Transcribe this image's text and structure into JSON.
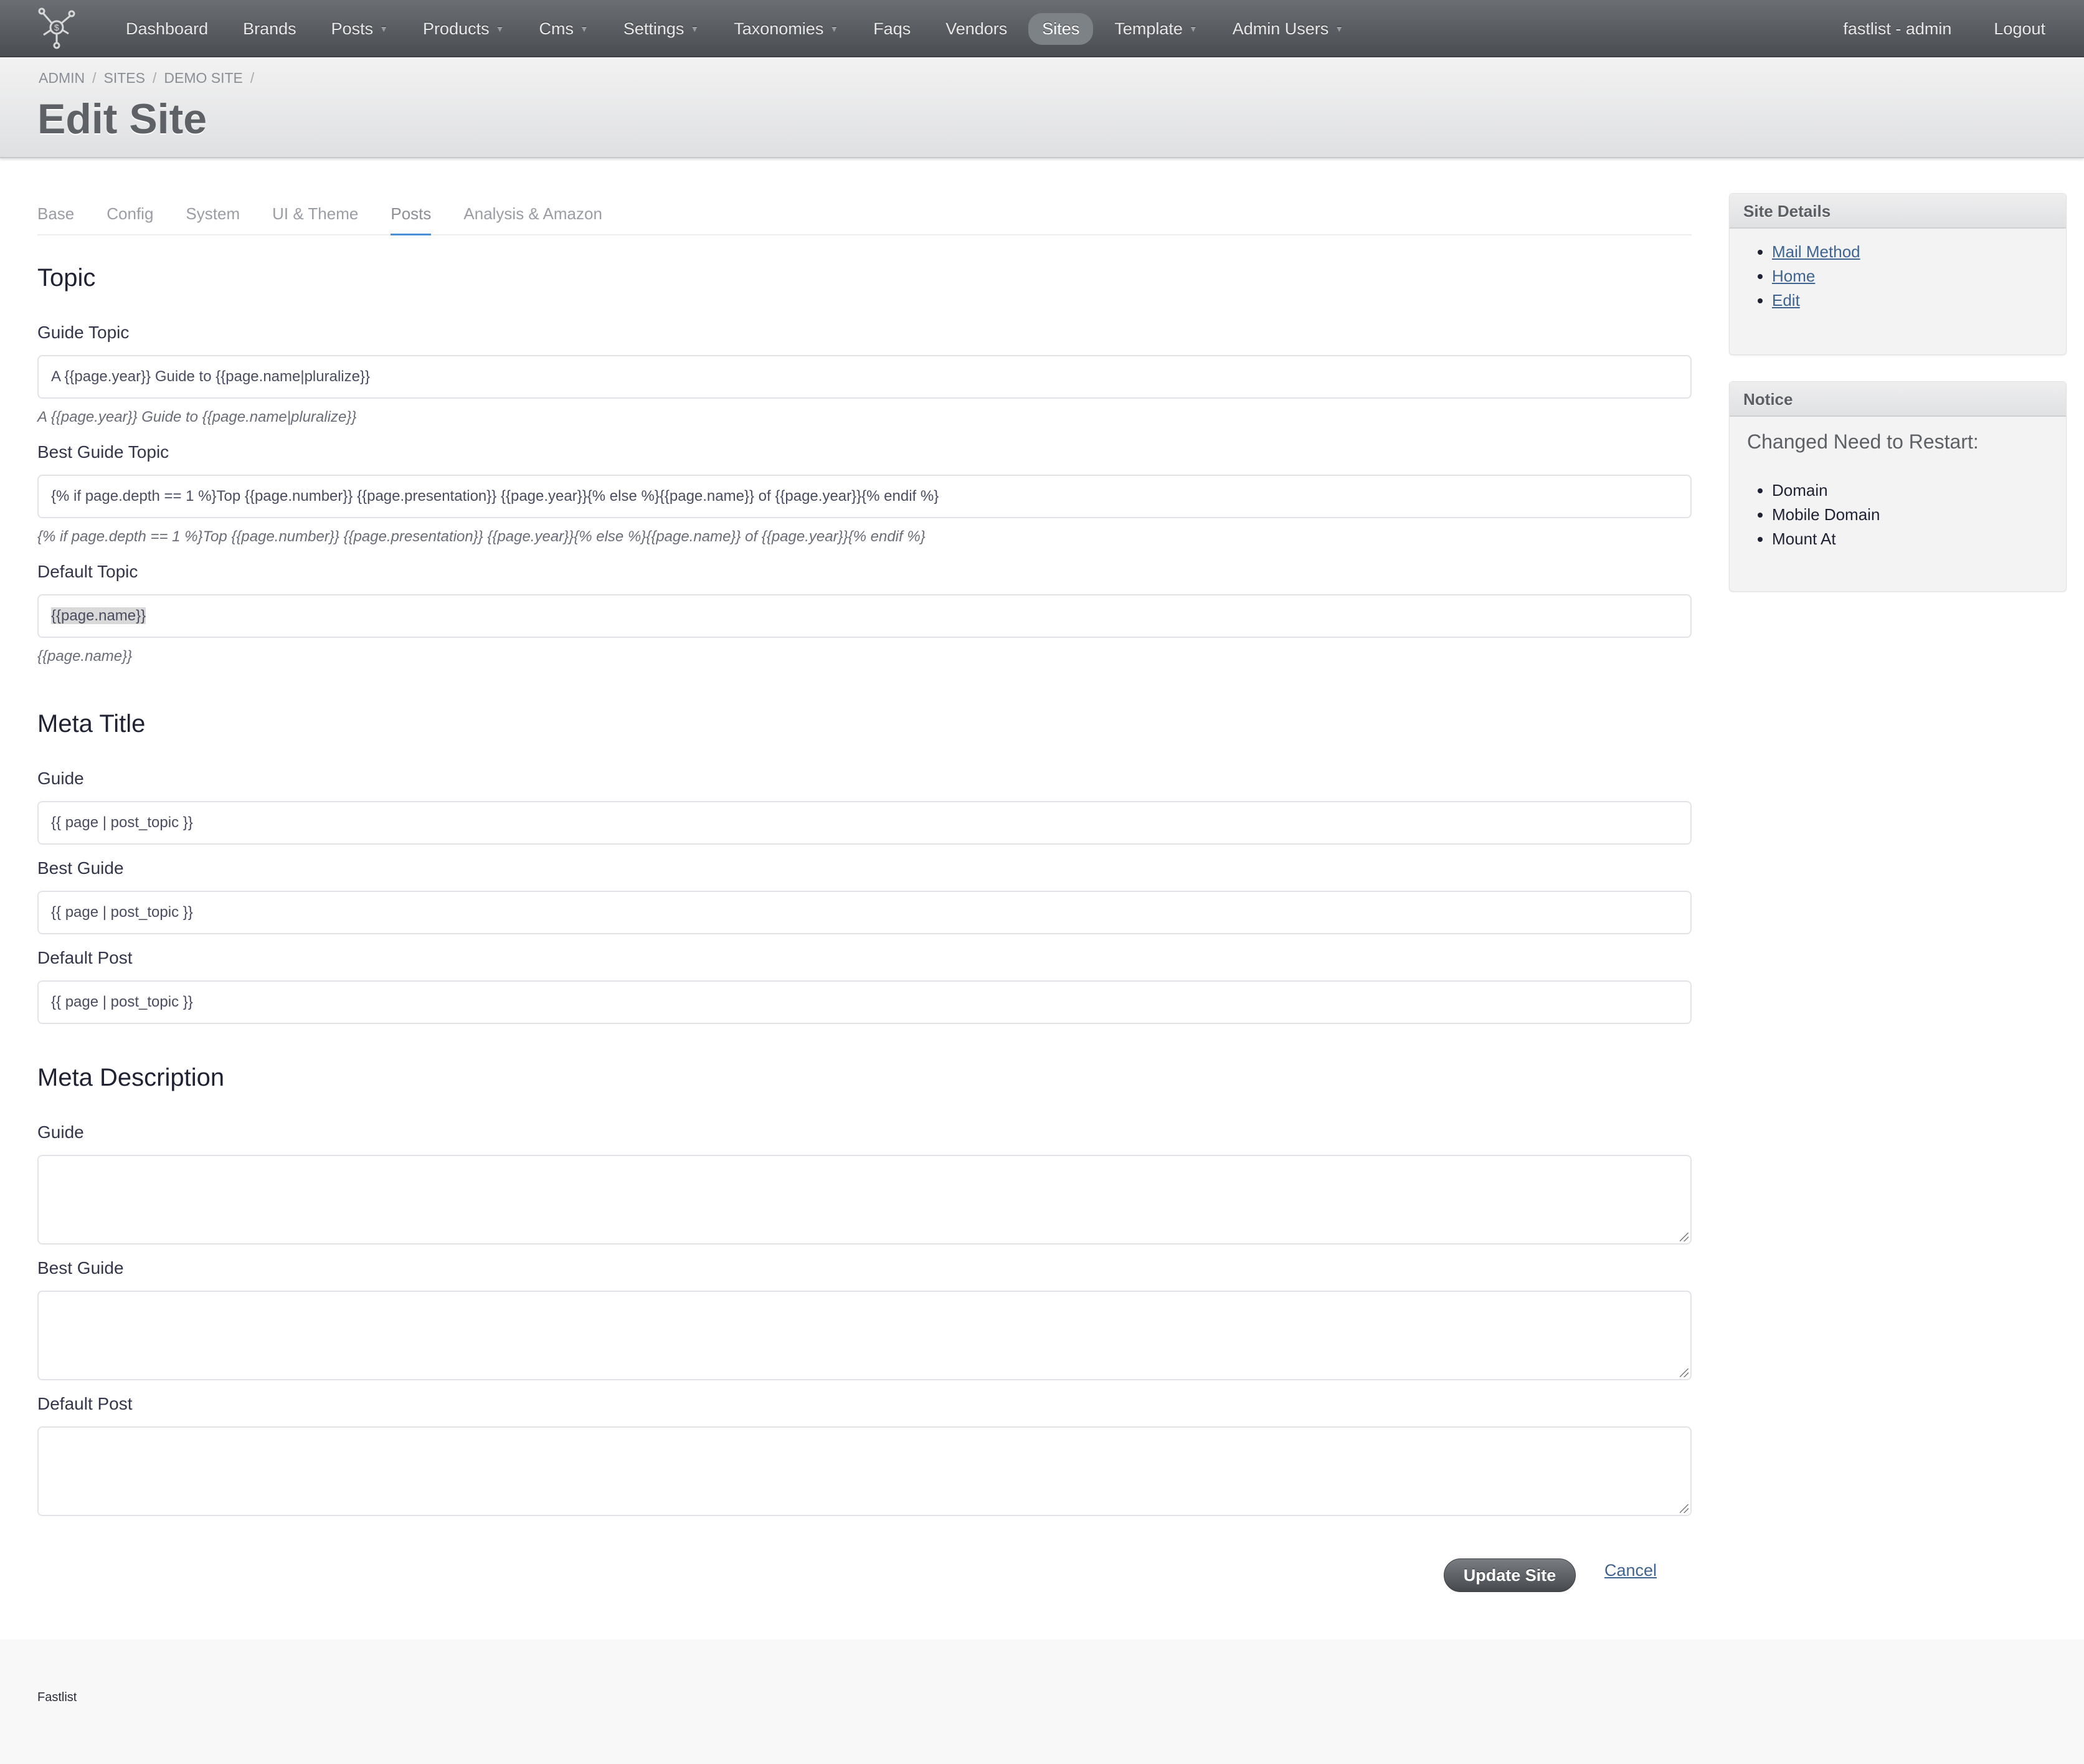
{
  "navbar": {
    "logo_icon": "network-hub-logo-icon",
    "items": [
      {
        "label": "Dashboard",
        "dropdown": false,
        "active": false
      },
      {
        "label": "Brands",
        "dropdown": false,
        "active": false
      },
      {
        "label": "Posts",
        "dropdown": true,
        "active": false
      },
      {
        "label": "Products",
        "dropdown": true,
        "active": false
      },
      {
        "label": "Cms",
        "dropdown": true,
        "active": false
      },
      {
        "label": "Settings",
        "dropdown": true,
        "active": false
      },
      {
        "label": "Taxonomies",
        "dropdown": true,
        "active": false
      },
      {
        "label": "Faqs",
        "dropdown": false,
        "active": false
      },
      {
        "label": "Vendors",
        "dropdown": false,
        "active": false
      },
      {
        "label": "Sites",
        "dropdown": false,
        "active": true
      },
      {
        "label": "Template",
        "dropdown": true,
        "active": false
      },
      {
        "label": "Admin Users",
        "dropdown": true,
        "active": false
      }
    ],
    "caret_glyph": "▼",
    "user_label": "fastlist - admin",
    "logout_label": "Logout"
  },
  "header": {
    "breadcrumb": [
      "ADMIN",
      "SITES",
      "DEMO SITE"
    ],
    "breadcrumb_sep": "/",
    "title": "Edit Site"
  },
  "tabs": [
    {
      "label": "Base",
      "active": false
    },
    {
      "label": "Config",
      "active": false
    },
    {
      "label": "System",
      "active": false
    },
    {
      "label": "UI & Theme",
      "active": false
    },
    {
      "label": "Posts",
      "active": true
    },
    {
      "label": "Analysis & Amazon",
      "active": false
    }
  ],
  "form": {
    "topic": {
      "title": "Topic",
      "guide_topic": {
        "label": "Guide Topic",
        "value": "A {{page.year}} Guide to {{page.name|pluralize}}",
        "hint": "A {{page.year}} Guide to {{page.name|pluralize}}"
      },
      "best_guide_topic": {
        "label": "Best Guide Topic",
        "value": "{% if page.depth == 1 %}Top {{page.number}} {{page.presentation}} {{page.year}}{% else %}{{page.name}} of {{page.year}}{% endif %}",
        "hint": "{% if page.depth == 1 %}Top {{page.number}} {{page.presentation}} {{page.year}}{% else %}{{page.name}} of {{page.year}}{% endif %}"
      },
      "default_topic": {
        "label": "Default Topic",
        "value": "{{page.name}}",
        "value_selected": true,
        "hint": "{{page.name}}"
      }
    },
    "meta_title": {
      "title": "Meta Title",
      "guide": {
        "label": "Guide",
        "value": "{{ page | post_topic }}"
      },
      "best_guide": {
        "label": "Best Guide",
        "value": "{{ page | post_topic }}"
      },
      "default_post": {
        "label": "Default Post",
        "value": "{{ page | post_topic }}"
      }
    },
    "meta_description": {
      "title": "Meta Description",
      "guide": {
        "label": "Guide",
        "value": ""
      },
      "best_guide": {
        "label": "Best Guide",
        "value": ""
      },
      "default_post": {
        "label": "Default Post",
        "value": ""
      }
    },
    "update_label": "Update Site",
    "cancel_label": "Cancel"
  },
  "sidebar": {
    "site_details": {
      "title": "Site Details",
      "links": [
        "Mail Method",
        "Home",
        "Edit"
      ]
    },
    "notice": {
      "title": "Notice",
      "heading": "Changed Need to Restart:",
      "items": [
        "Domain",
        "Mobile Domain",
        "Mount At"
      ]
    }
  },
  "footer": {
    "text": "Fastlist"
  },
  "colors": {
    "navbar": "#5a5e63",
    "active_tab_underline": "#4a90d9",
    "link": "#3f6490",
    "update_button": "#55585d"
  }
}
